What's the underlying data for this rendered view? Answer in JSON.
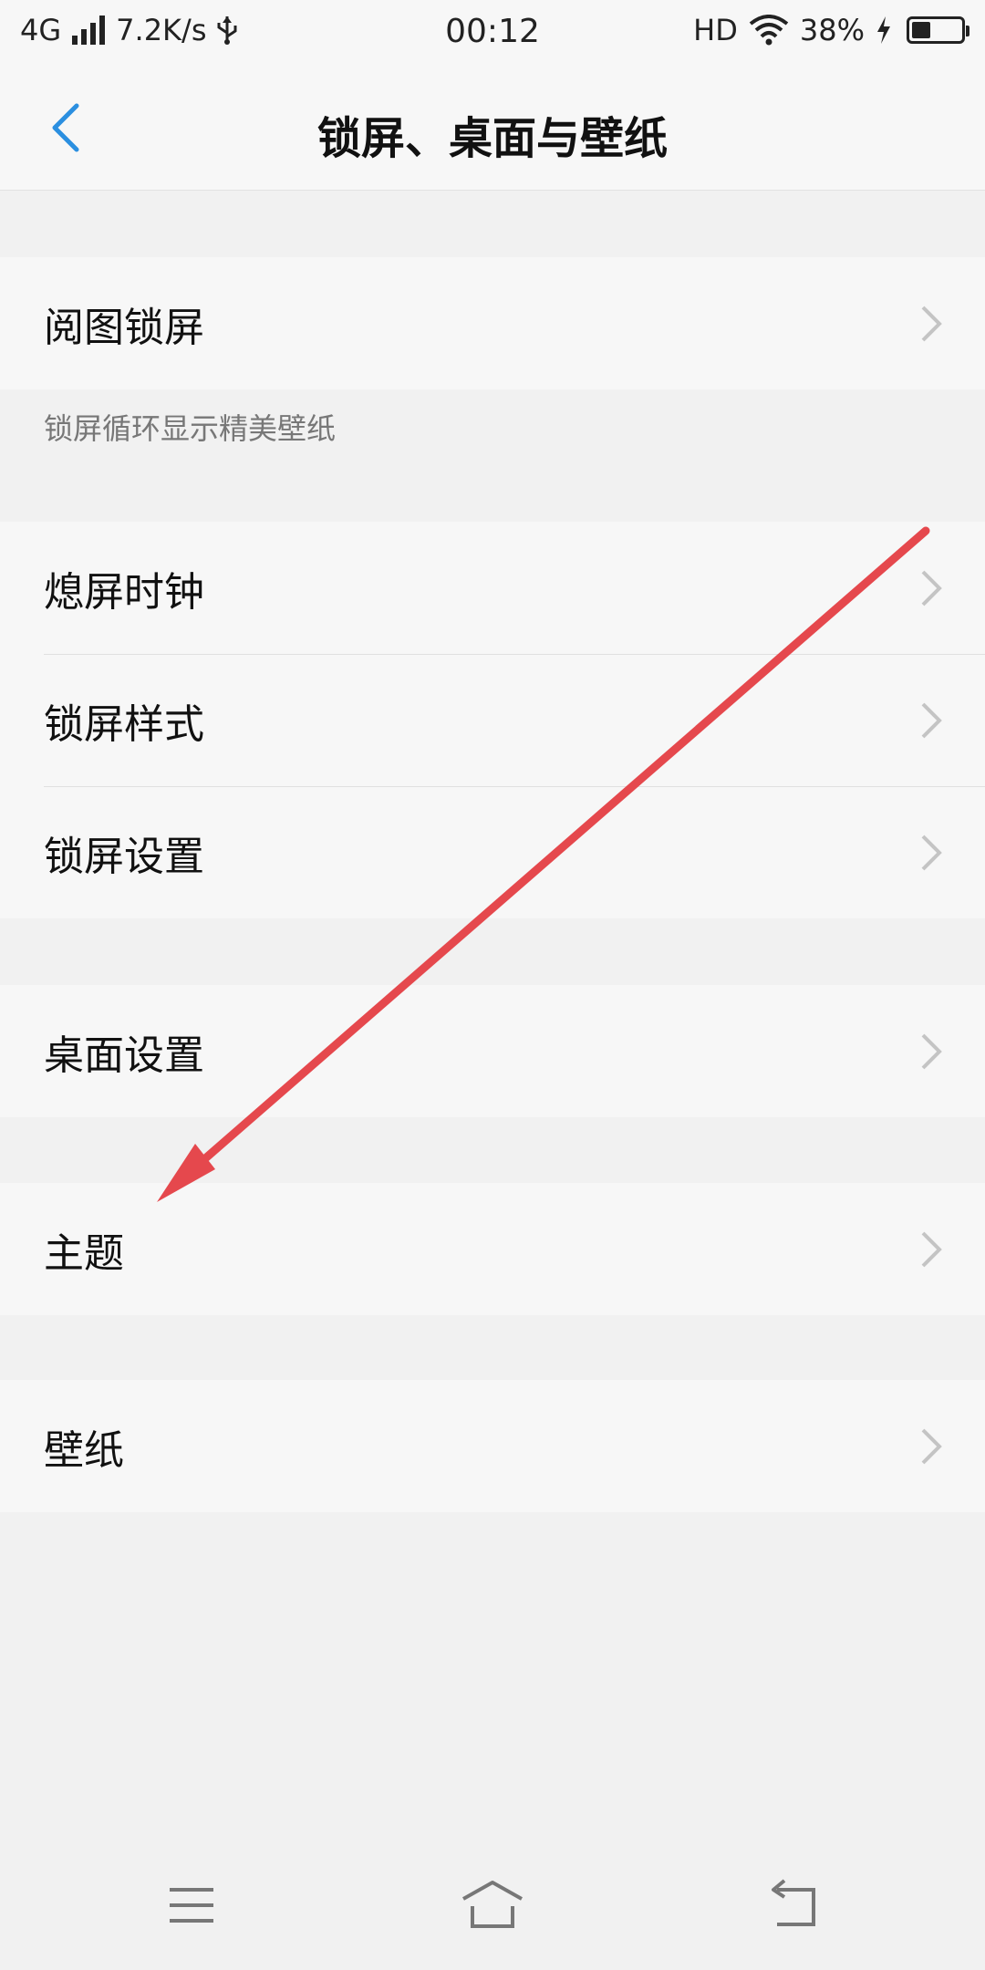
{
  "status_bar": {
    "network": "4G",
    "speed": "7.2K/s",
    "time": "00:12",
    "hd": "HD",
    "battery": "38%",
    "battery_level": 0.38
  },
  "header": {
    "title": "锁屏、桌面与壁纸"
  },
  "sections": [
    {
      "items": [
        {
          "label": "阅图锁屏"
        }
      ],
      "caption": "锁屏循环显示精美壁纸"
    },
    {
      "items": [
        {
          "label": "熄屏时钟"
        },
        {
          "label": "锁屏样式"
        },
        {
          "label": "锁屏设置"
        }
      ]
    },
    {
      "items": [
        {
          "label": "桌面设置"
        }
      ]
    },
    {
      "items": [
        {
          "label": "主题"
        }
      ]
    },
    {
      "items": [
        {
          "label": "壁纸"
        }
      ]
    }
  ],
  "colors": {
    "accent": "#2b8fe0",
    "annotation_arrow": "#e5484d",
    "chevron": "#c4c4c4"
  }
}
